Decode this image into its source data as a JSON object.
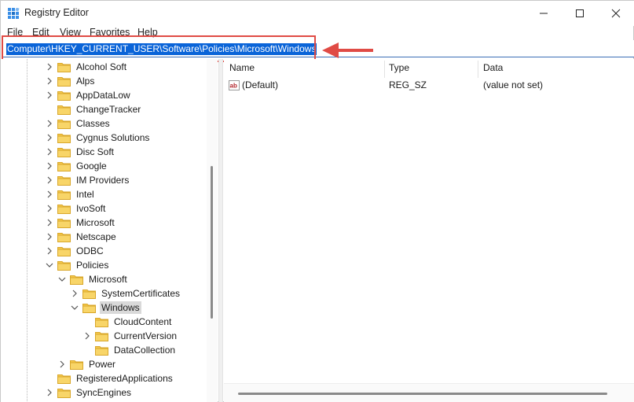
{
  "window": {
    "title": "Registry Editor",
    "controls": {
      "minimize": "minimize",
      "maximize": "maximize",
      "close": "close"
    }
  },
  "menu": {
    "items": [
      {
        "label": "File"
      },
      {
        "label": "Edit"
      },
      {
        "label": "View"
      },
      {
        "label": "Favorites"
      },
      {
        "label": "Help"
      }
    ]
  },
  "address": {
    "path": "Computer\\HKEY_CURRENT_USER\\Software\\Policies\\Microsoft\\Windows"
  },
  "tree": {
    "items": [
      {
        "label": "Alcohol Soft",
        "expanded": false
      },
      {
        "label": "Alps",
        "expanded": false
      },
      {
        "label": "AppDataLow",
        "expanded": false
      },
      {
        "label": "ChangeTracker",
        "expanded": null
      },
      {
        "label": "Classes",
        "expanded": false
      },
      {
        "label": "Cygnus Solutions",
        "expanded": false
      },
      {
        "label": "Disc Soft",
        "expanded": false
      },
      {
        "label": "Google",
        "expanded": false
      },
      {
        "label": "IM Providers",
        "expanded": false
      },
      {
        "label": "Intel",
        "expanded": false
      },
      {
        "label": "IvoSoft",
        "expanded": false
      },
      {
        "label": "Microsoft",
        "expanded": false
      },
      {
        "label": "Netscape",
        "expanded": false
      },
      {
        "label": "ODBC",
        "expanded": false
      },
      {
        "label": "Policies",
        "expanded": true
      },
      {
        "label": "Microsoft",
        "expanded": true
      },
      {
        "label": "SystemCertificates",
        "expanded": false
      },
      {
        "label": "Windows",
        "expanded": true,
        "selected": true
      },
      {
        "label": "CloudContent",
        "expanded": null
      },
      {
        "label": "CurrentVersion",
        "expanded": false
      },
      {
        "label": "DataCollection",
        "expanded": null
      },
      {
        "label": "Power",
        "expanded": false
      },
      {
        "label": "RegisteredApplications",
        "expanded": null
      },
      {
        "label": "SyncEngines",
        "expanded": false
      }
    ]
  },
  "list": {
    "columns": {
      "name": "Name",
      "type": "Type",
      "data": "Data"
    },
    "rows": [
      {
        "name": "(Default)",
        "type": "REG_SZ",
        "data": "(value not set)",
        "icon": "string-value-icon"
      }
    ]
  },
  "colors": {
    "selection": "#0a64d8",
    "highlight_box": "#e04b45",
    "folder": "#f5c84c"
  }
}
